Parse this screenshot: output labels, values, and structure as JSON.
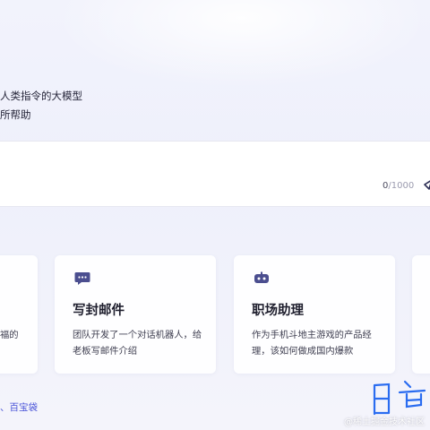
{
  "intro": {
    "line1": "人类指令的大模型",
    "line2": "所帮助"
  },
  "input": {
    "count": "0",
    "max": "/1000"
  },
  "cards": [
    {
      "desc_partial": "福的"
    },
    {
      "title": "写封邮件",
      "desc": "团队开发了一个对话机器人，给老板写邮件介绍",
      "icon": "chat-bubble-icon"
    },
    {
      "title": "职场助理",
      "desc": "作为手机斗地主游戏的产品经理，该如何做成国内爆款",
      "icon": "robot-icon"
    },
    {}
  ],
  "bottom_link": "、百宝袋",
  "watermark": "@稀土掘金技术社区",
  "colors": {
    "accent": "#4a54d8",
    "icon": "#4b4e8f"
  }
}
